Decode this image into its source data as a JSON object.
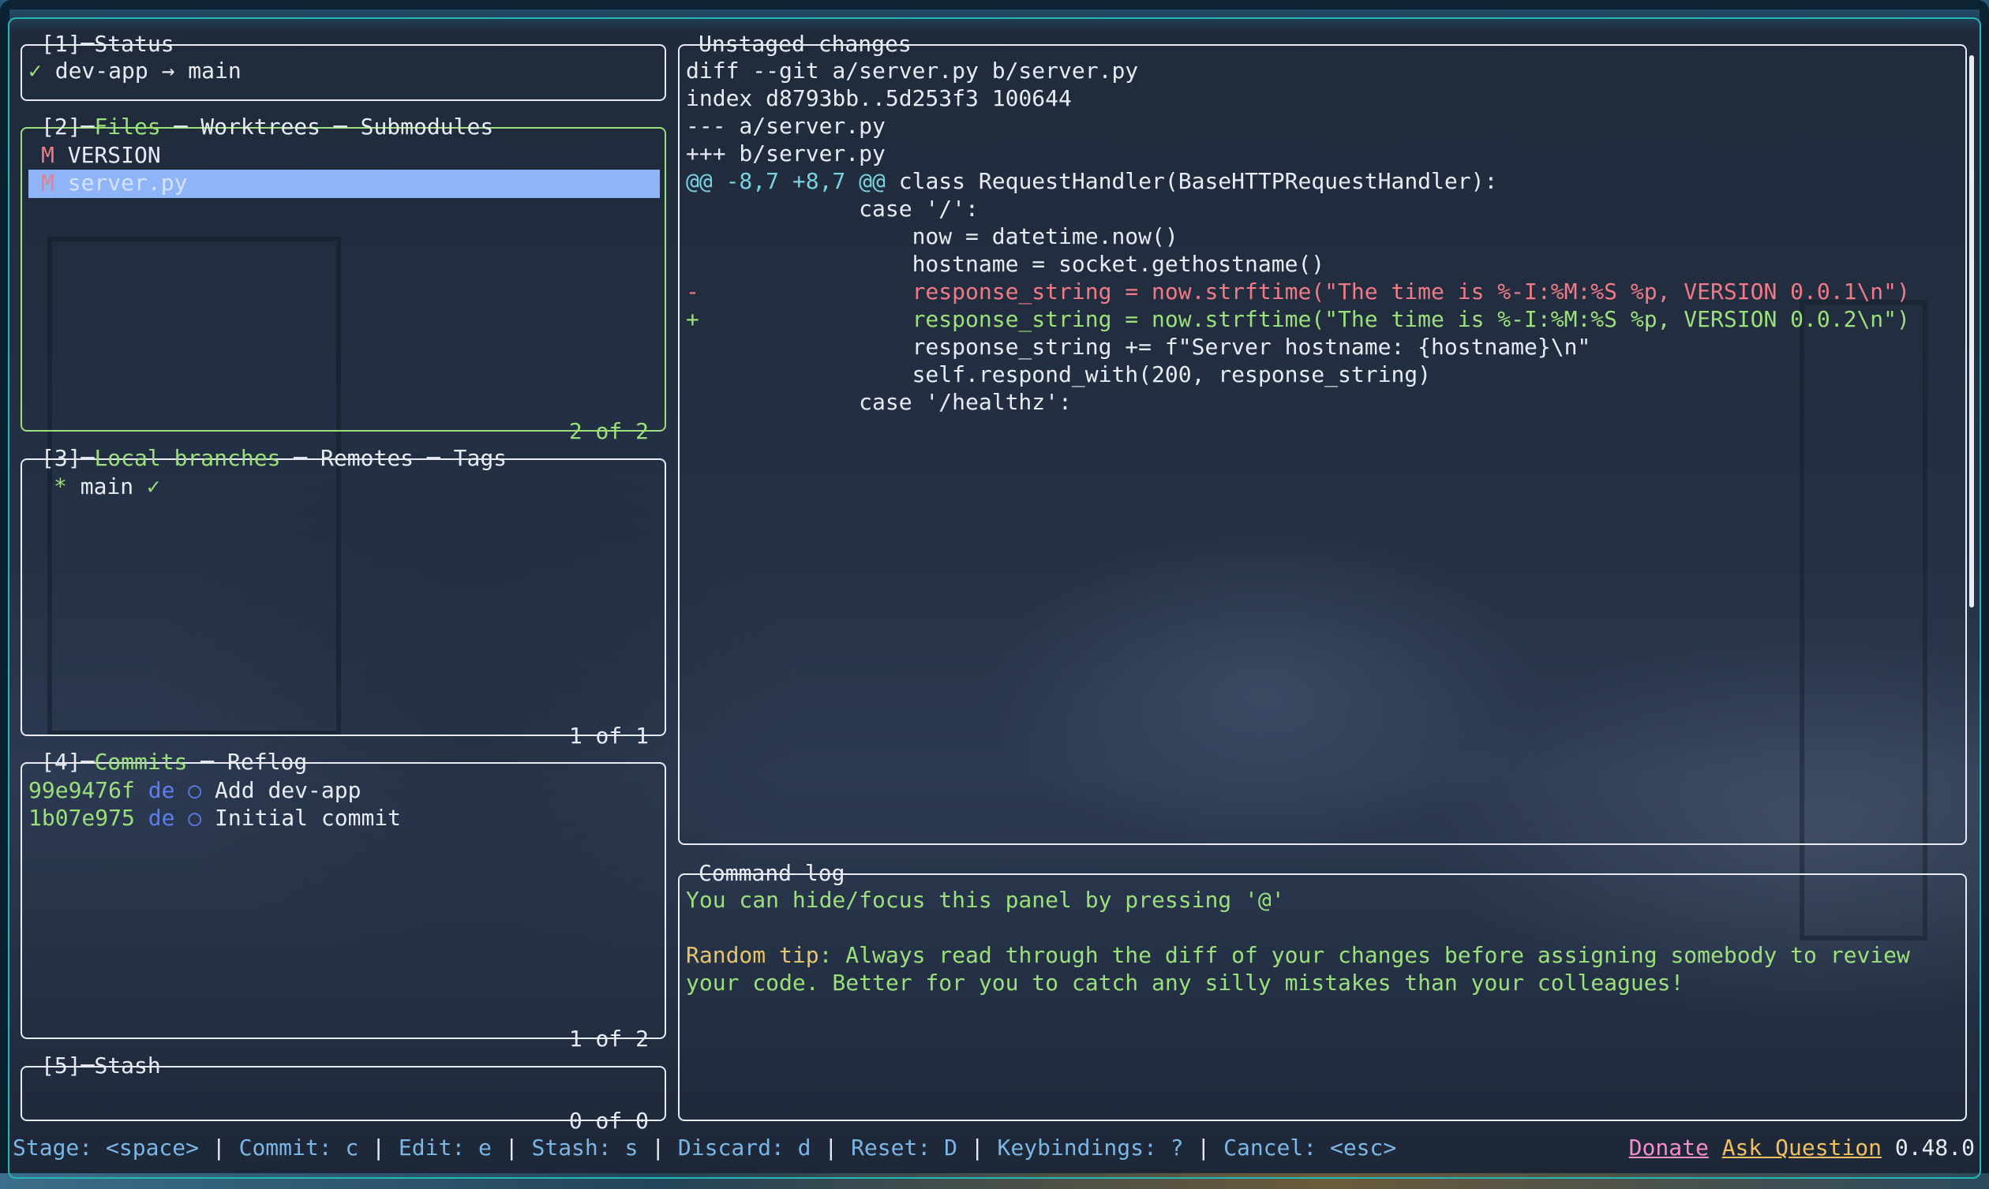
{
  "status": {
    "title": "[1]─Status",
    "check": "✓",
    "repo": "dev-app → main"
  },
  "files": {
    "title_num": "[2]─",
    "title_active": "Files",
    "title_rest": " ─ Worktrees ─ Submodules",
    "items": [
      {
        "status": "M",
        "name": "VERSION"
      },
      {
        "status": "M",
        "name": "server.py"
      }
    ],
    "footer": "2 of 2"
  },
  "branches": {
    "title_num": "[3]─",
    "title_active": "Local branches",
    "title_rest": " ─ Remotes ─ Tags",
    "items": [
      {
        "marker": "*",
        "name": "main",
        "check": "✓"
      }
    ],
    "footer": "1 of 1"
  },
  "commits": {
    "title_num": "[4]─",
    "title_active": "Commits",
    "title_rest": " ─ Reflog",
    "items": [
      {
        "hash": "99e9476f",
        "author": "de",
        "marker": "○",
        "message": "Add dev-app"
      },
      {
        "hash": "1b07e975",
        "author": "de",
        "marker": "○",
        "message": "Initial commit"
      }
    ],
    "footer": "1 of 2"
  },
  "stash": {
    "title": "[5]─Stash",
    "footer": "0 of 0"
  },
  "diff": {
    "title": "Unstaged changes",
    "lines": [
      {
        "text": "diff --git a/server.py b/server.py",
        "color": "#e8ecf2"
      },
      {
        "text": "index d8793bb..5d253f3 100644",
        "color": "#e8ecf2"
      },
      {
        "text": "--- a/server.py",
        "color": "#e8ecf2"
      },
      {
        "text": "+++ b/server.py",
        "color": "#e8ecf2"
      },
      {
        "text": "@@ -8,7 +8,7 @@",
        "color": "#7ad1e0",
        "rest": " class RequestHandler(BaseHTTPRequestHandler):"
      },
      {
        "text": "             case '/':",
        "color": "#e8ecf2"
      },
      {
        "text": "                 now = datetime.now()",
        "color": "#e8ecf2"
      },
      {
        "text": "                 hostname = socket.gethostname()",
        "color": "#e8ecf2"
      },
      {
        "text": "-                response_string = now.strftime(\"The time is %-I:%M:%S %p, VERSION 0.0.1\\n\")",
        "color": "#f07a86"
      },
      {
        "text": "+                response_string = now.strftime(\"The time is %-I:%M:%S %p, VERSION 0.0.2\\n\")",
        "color": "#9be07a"
      },
      {
        "text": "                 response_string += f\"Server hostname: {hostname}\\n\"",
        "color": "#e8ecf2"
      },
      {
        "text": "                 self.respond_with(200, response_string)",
        "color": "#e8ecf2"
      },
      {
        "text": "             case '/healthz':",
        "color": "#e8ecf2"
      }
    ]
  },
  "command_log": {
    "title": "Command log",
    "hint": "You can hide/focus this panel by pressing '@'",
    "tip_label": "Random tip",
    "tip_text": ": Always read through the diff of your changes before assigning somebody to review",
    "tip_text2": "your code. Better for you to catch any silly mistakes than your colleagues!"
  },
  "statusbar": {
    "items": [
      "Stage: <space>",
      "Commit: c",
      "Edit: e",
      "Stash: s",
      "Discard: d",
      "Reset: D",
      "Keybindings: ?",
      "Cancel: <esc>"
    ],
    "separator": " | ",
    "donate": "Donate",
    "ask": "Ask Question",
    "version": "0.48.0"
  },
  "colors": {
    "border_default": "#e8ecf2",
    "border_active": "#9be07a",
    "selection": "#8fb4f7",
    "modified": "#f07a86",
    "author": "#5d7df0",
    "hunk": "#7ad1e0",
    "keybinding": "#7ab6e6",
    "terminal_frame": "#23b8b8"
  }
}
